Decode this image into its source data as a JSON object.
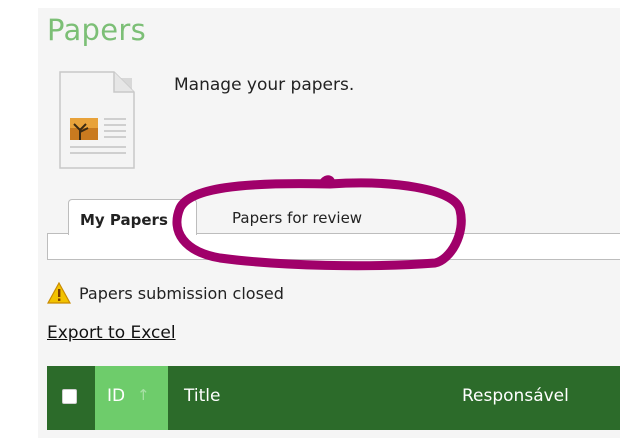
{
  "page": {
    "title": "Papers",
    "subtitle": "Manage your papers.",
    "icon": "document-icon"
  },
  "tabs": [
    {
      "label": "My Papers",
      "active": true
    },
    {
      "label": "Papers for review",
      "active": false
    }
  ],
  "notice": {
    "icon": "warning-icon",
    "text": "Papers submission closed"
  },
  "actions": {
    "export_label": "Export to Excel"
  },
  "grid": {
    "columns": [
      {
        "label": "ID",
        "sorted": "ascending"
      },
      {
        "label": "Title"
      },
      {
        "label": "Responsável"
      }
    ],
    "sort_icon": "sort-up-icon"
  },
  "colors": {
    "title": "#7cbf76",
    "header_bg": "#2c6b2a",
    "sorted_col_bg": "#6ecc6b",
    "highlight_marker": "#a0006a"
  }
}
